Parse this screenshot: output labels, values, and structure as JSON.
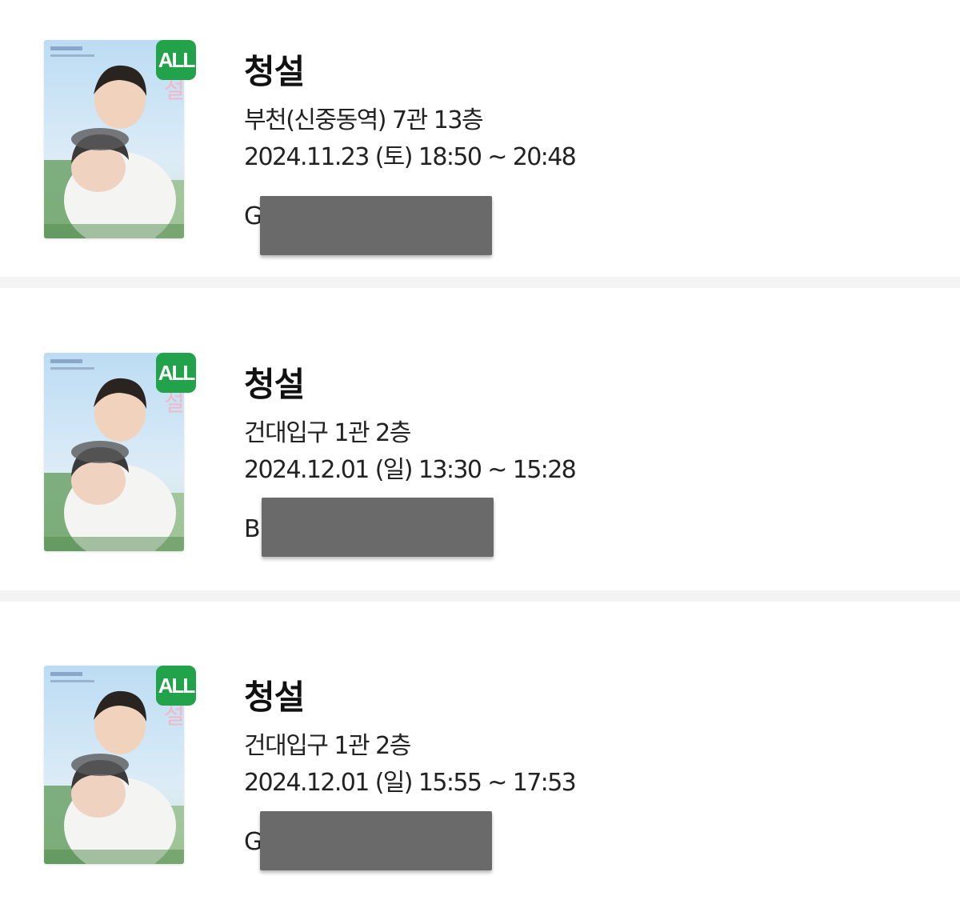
{
  "tickets": [
    {
      "rating": "ALL",
      "title": "청설",
      "location": "부천(신중동역) 7관 13층",
      "datetime": "2024.11.23 (토) 18:50 ~ 20:48",
      "seat_prefix": "G"
    },
    {
      "rating": "ALL",
      "title": "청설",
      "location": "건대입구 1관 2층",
      "datetime": "2024.12.01 (일) 13:30 ~ 15:28",
      "seat_prefix": "B"
    },
    {
      "rating": "ALL",
      "title": "청설",
      "location": "건대입구 1관 2층",
      "datetime": "2024.12.01 (일) 15:55 ~ 17:53",
      "seat_prefix": "G"
    }
  ],
  "colors": {
    "rating_badge": "#22a24a",
    "redaction": "#6a6a6a",
    "divider": "#f4f4f4"
  },
  "icons": {
    "poster": "movie-poster-image"
  }
}
